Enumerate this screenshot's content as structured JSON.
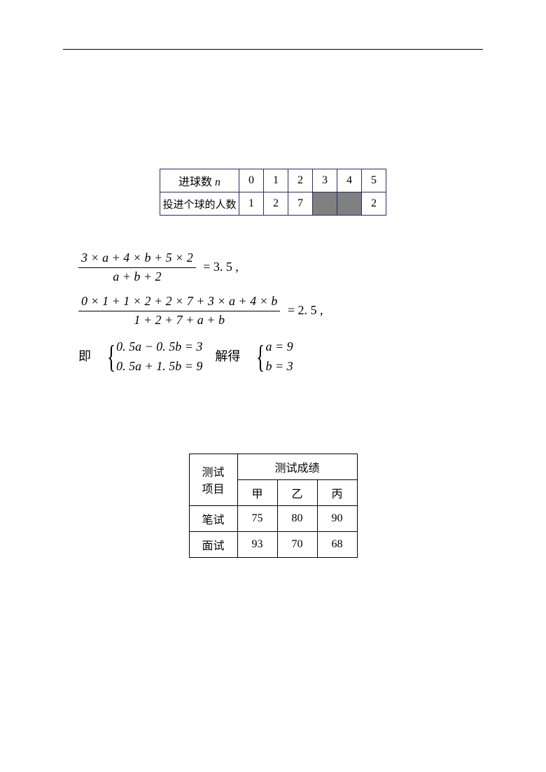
{
  "table1": {
    "row1_label_pre": "进球数 ",
    "row1_label_var": "n",
    "cols": [
      "0",
      "1",
      "2",
      "3",
      "4",
      "5"
    ],
    "row2_label": "投进个球的人数",
    "row2_vals": [
      "1",
      "2",
      "7",
      "",
      "",
      "2"
    ]
  },
  "math": {
    "eq1_num": "3 × a + 4 × b + 5 × 2",
    "eq1_den": "a + b + 2",
    "eq1_rhs": "= 3. 5 ,",
    "eq2_num": "0 × 1 + 1 × 2 + 2 × 7 + 3 × a + 4 × b",
    "eq2_den": "1 + 2 + 7 + a + b",
    "eq2_rhs": "= 2. 5 ,",
    "word_ie": "即",
    "sys1_a": "0. 5a − 0. 5b = 3",
    "sys1_b": "0. 5a + 1. 5b = 9",
    "word_solve": "解得",
    "sys2_a": "a = 9",
    "sys2_b": "b = 3"
  },
  "table2": {
    "topleft_l1": "测试",
    "topleft_l2": "项目",
    "topright": "测试成绩",
    "cols": [
      "甲",
      "乙",
      "丙"
    ],
    "rows": [
      {
        "label": "笔试",
        "vals": [
          "75",
          "80",
          "90"
        ]
      },
      {
        "label": "面试",
        "vals": [
          "93",
          "70",
          "68"
        ]
      }
    ]
  },
  "chart_data": [
    {
      "type": "table",
      "title": "进球数频数表",
      "categories": [
        "0",
        "1",
        "2",
        "3",
        "4",
        "5"
      ],
      "series": [
        {
          "name": "投进个球的人数",
          "values": [
            1,
            2,
            7,
            null,
            null,
            2
          ]
        }
      ]
    },
    {
      "type": "table",
      "title": "测试成绩",
      "categories": [
        "甲",
        "乙",
        "丙"
      ],
      "series": [
        {
          "name": "笔试",
          "values": [
            75,
            80,
            90
          ]
        },
        {
          "name": "面试",
          "values": [
            93,
            70,
            68
          ]
        }
      ]
    }
  ]
}
